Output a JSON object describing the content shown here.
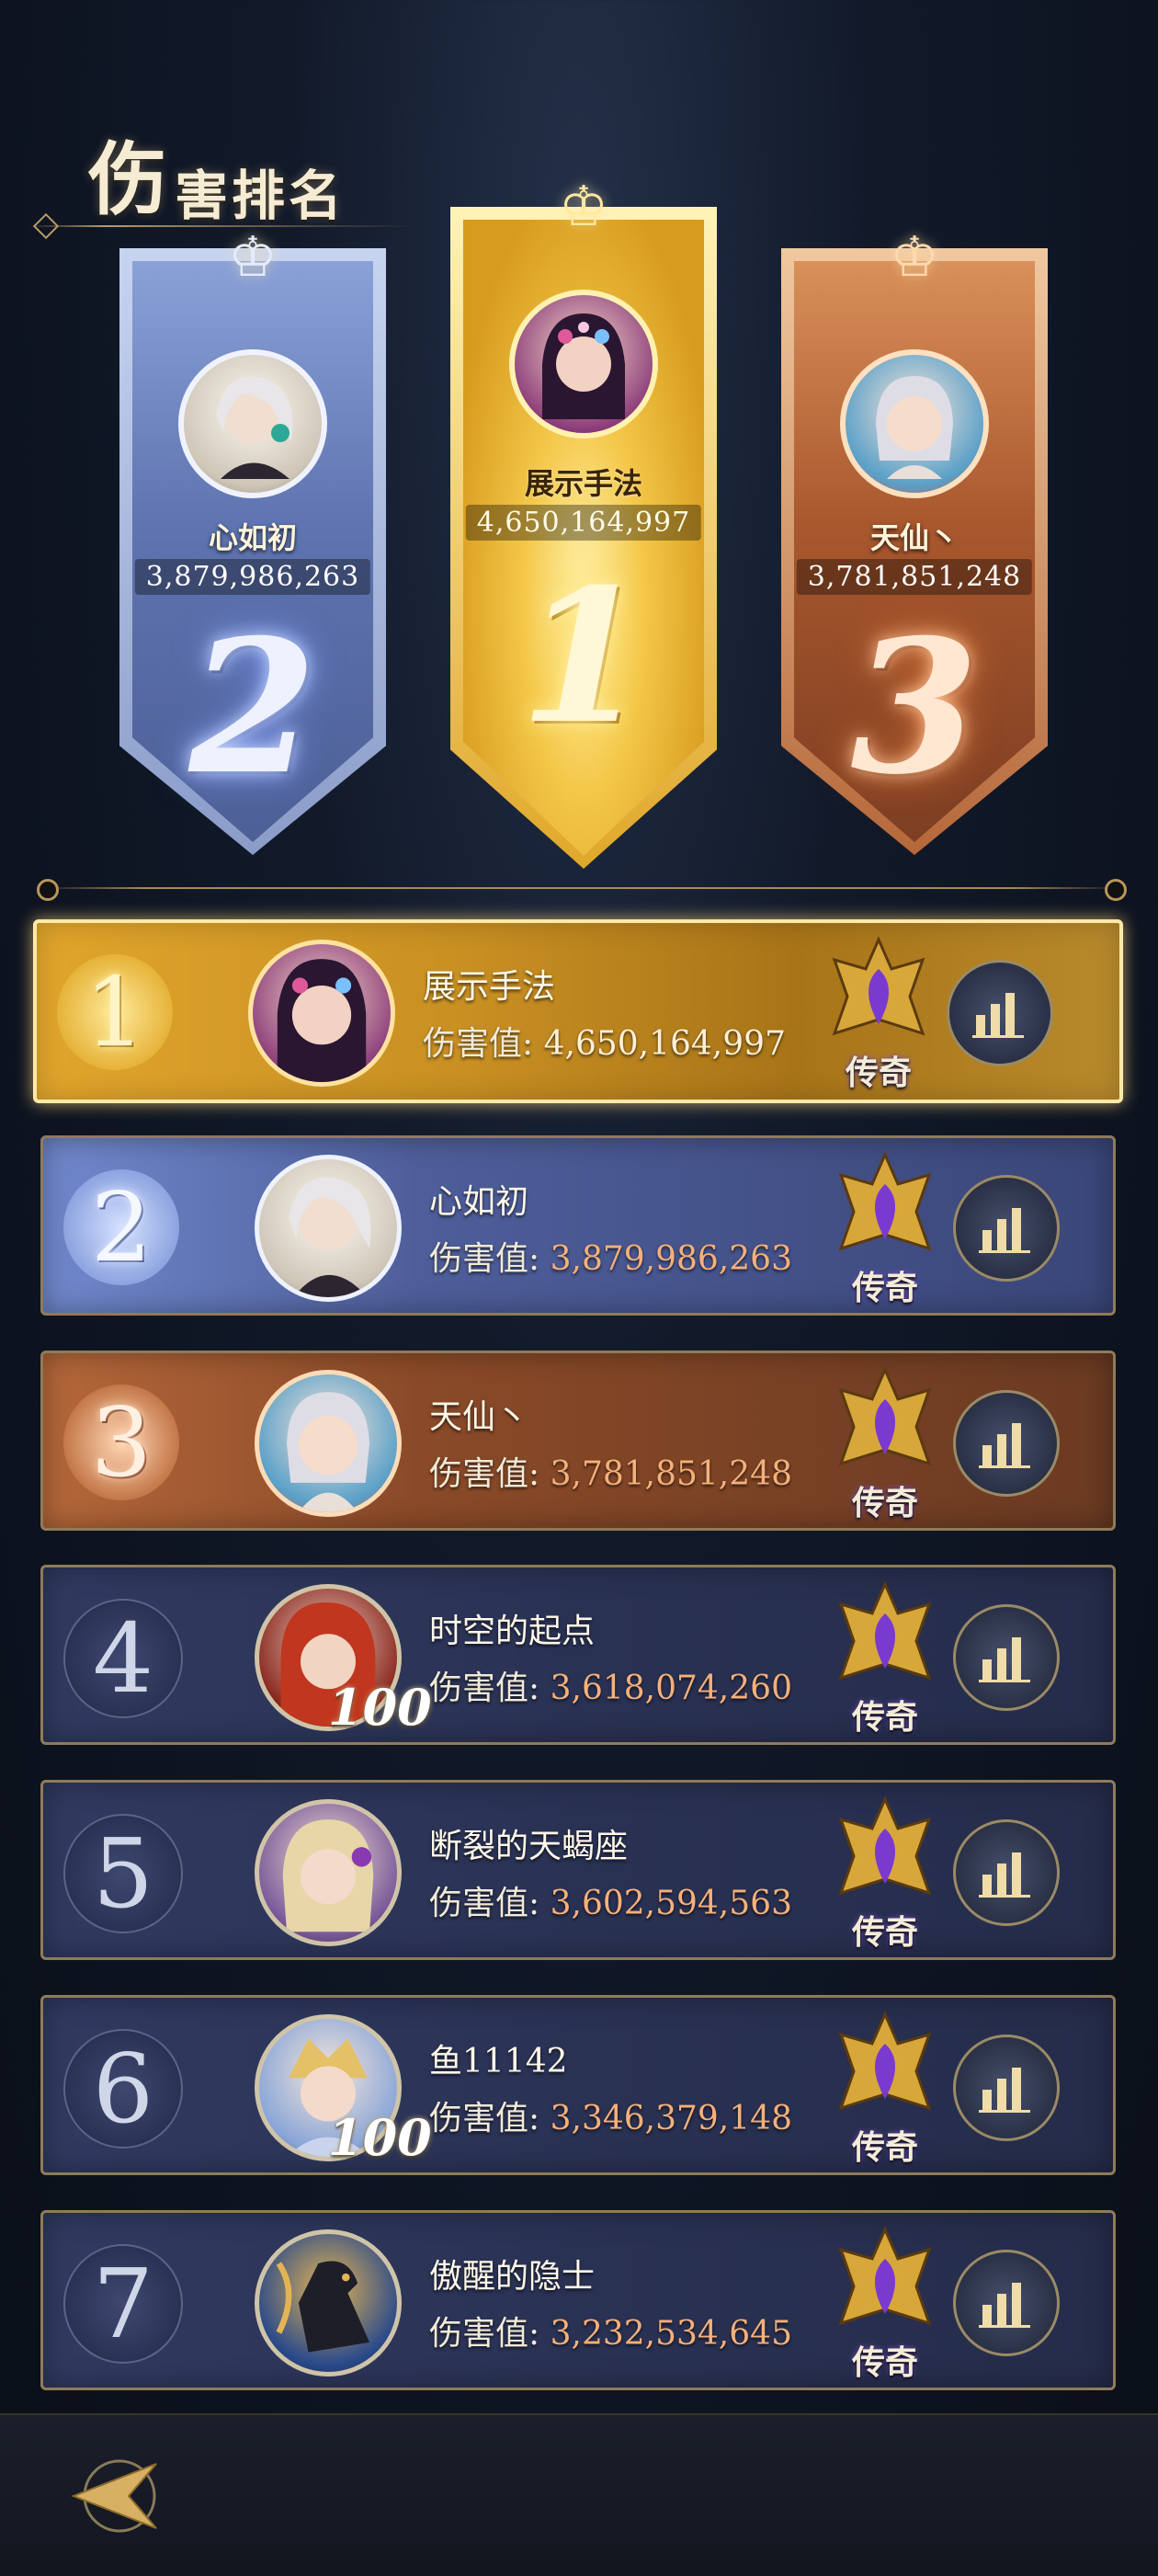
{
  "header": {
    "title_first": "伤",
    "title_rest": "害排名"
  },
  "podium": [
    {
      "rank": "2",
      "name": "心如初",
      "score": "3,879,986,263"
    },
    {
      "rank": "1",
      "name": "展示手法",
      "score": "4,650,164,997"
    },
    {
      "rank": "3",
      "name": "天仙丶",
      "score": "3,781,851,248"
    }
  ],
  "rows": [
    {
      "rank": "1",
      "name": "展示手法",
      "damage_label": "伤害值:",
      "damage": "4,650,164,997",
      "badge": "传奇",
      "level": ""
    },
    {
      "rank": "2",
      "name": "心如初",
      "damage_label": "伤害值:",
      "damage": "3,879,986,263",
      "badge": "传奇",
      "level": ""
    },
    {
      "rank": "3",
      "name": "天仙丶",
      "damage_label": "伤害值:",
      "damage": "3,781,851,248",
      "badge": "传奇",
      "level": ""
    },
    {
      "rank": "4",
      "name": "时空的起点",
      "damage_label": "伤害值:",
      "damage": "3,618,074,260",
      "badge": "传奇",
      "level": "100"
    },
    {
      "rank": "5",
      "name": "断裂的天蝎座",
      "damage_label": "伤害值:",
      "damage": "3,602,594,563",
      "badge": "传奇",
      "level": ""
    },
    {
      "rank": "6",
      "name": "鱼11142",
      "damage_label": "伤害值:",
      "damage": "3,346,379,148",
      "badge": "传奇",
      "level": "100"
    },
    {
      "rank": "7",
      "name": "傲醒的隐士",
      "damage_label": "伤害值:",
      "damage": "3,232,534,645",
      "badge": "传奇",
      "level": ""
    }
  ],
  "colors": {
    "gold": "#e8b93a",
    "silver": "#6f86c6",
    "bronze": "#b86a3c",
    "normal": "#2e3658"
  }
}
